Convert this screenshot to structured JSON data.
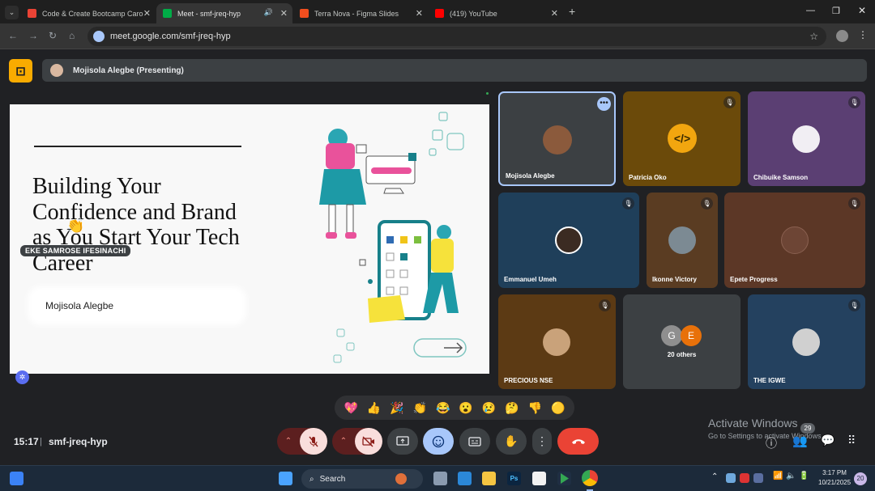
{
  "browser": {
    "tabs": [
      {
        "title": "Code & Create Bootcamp Caro",
        "icon": "gmail-icon",
        "color": "#ea4335"
      },
      {
        "title": "Meet - smf-jreq-hyp",
        "icon": "meet-icon",
        "color": "#00ac47"
      },
      {
        "title": "Terra Nova - Figma Slides",
        "icon": "figma-icon",
        "color": "#f24e1e"
      },
      {
        "title": "(419) YouTube",
        "icon": "youtube-icon",
        "color": "#ff0000"
      }
    ],
    "url": "meet.google.com/smf-jreq-hyp"
  },
  "meet": {
    "presenting_label": "Mojisola Alegbe (Presenting)",
    "slide": {
      "title": "Building Your Confidence and Brand as You Start Your Tech Career",
      "author": "Mojisola Alegbe",
      "caption": "EKE SAMROSE IFESINACHI"
    },
    "participants": [
      {
        "name": "Mojisola Alegbe",
        "bg": "#3c4043",
        "muted": false
      },
      {
        "name": "Patricia Oko",
        "bg": "#6b4a0a",
        "muted": true
      },
      {
        "name": "Chibuike Samson",
        "bg": "#5b3f73",
        "muted": true
      },
      {
        "name": "Emmanuel Umeh",
        "bg": "#1f3f5a",
        "muted": true
      },
      {
        "name": "Ikonne Victory",
        "bg": "#5a3c22",
        "muted": true
      },
      {
        "name": "Epete Progress",
        "bg": "#5c3726",
        "muted": true
      },
      {
        "name": "PRECIOUS NSE",
        "bg": "#5c3a14",
        "muted": true
      },
      {
        "name": "20 others",
        "bg": "#3c4043",
        "muted": false
      },
      {
        "name": "THE IGWE",
        "bg": "#24415f",
        "muted": true
      }
    ],
    "others_initials": [
      "G",
      "E"
    ],
    "reactions": [
      "💖",
      "👍",
      "🎉",
      "👏",
      "😂",
      "😮",
      "😢",
      "🤔",
      "👎",
      "🟡"
    ],
    "clock": "15:17",
    "meeting_code": "smf-jreq-hyp",
    "people_count": "29",
    "end_call_color": "#ea4335"
  },
  "windows": {
    "watermark_title": "Activate Windows",
    "watermark_sub": "Go to Settings to activate Windows.",
    "search": "Search",
    "time": "3:17 PM",
    "date": "10/21/2025",
    "notifications": "20"
  }
}
